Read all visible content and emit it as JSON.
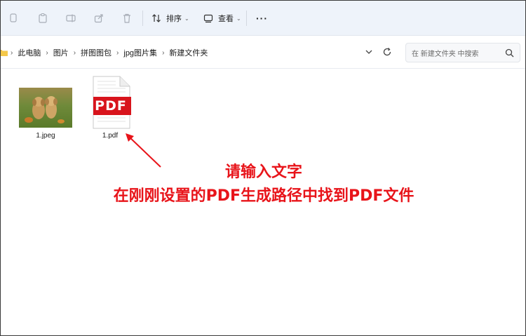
{
  "toolbar": {
    "sort_label": "排序",
    "view_label": "查看",
    "more_label": "···"
  },
  "breadcrumb": {
    "items": [
      "此电脑",
      "图片",
      "拼图图包",
      "jpg图片集",
      "新建文件夹"
    ]
  },
  "search": {
    "placeholder": "在 新建文件夹 中搜索"
  },
  "files": [
    {
      "name": "1.jpeg",
      "type": "image"
    },
    {
      "name": "1.pdf",
      "type": "pdf",
      "badge": "PDF"
    }
  ],
  "annotation": {
    "line1": "请输入文字",
    "line2": "在刚刚设置的PDF生成路径中找到PDF文件",
    "color": "#e8141a"
  },
  "colors": {
    "toolbar_bg": "#eef3fa",
    "pdf_red": "#d8141c"
  }
}
